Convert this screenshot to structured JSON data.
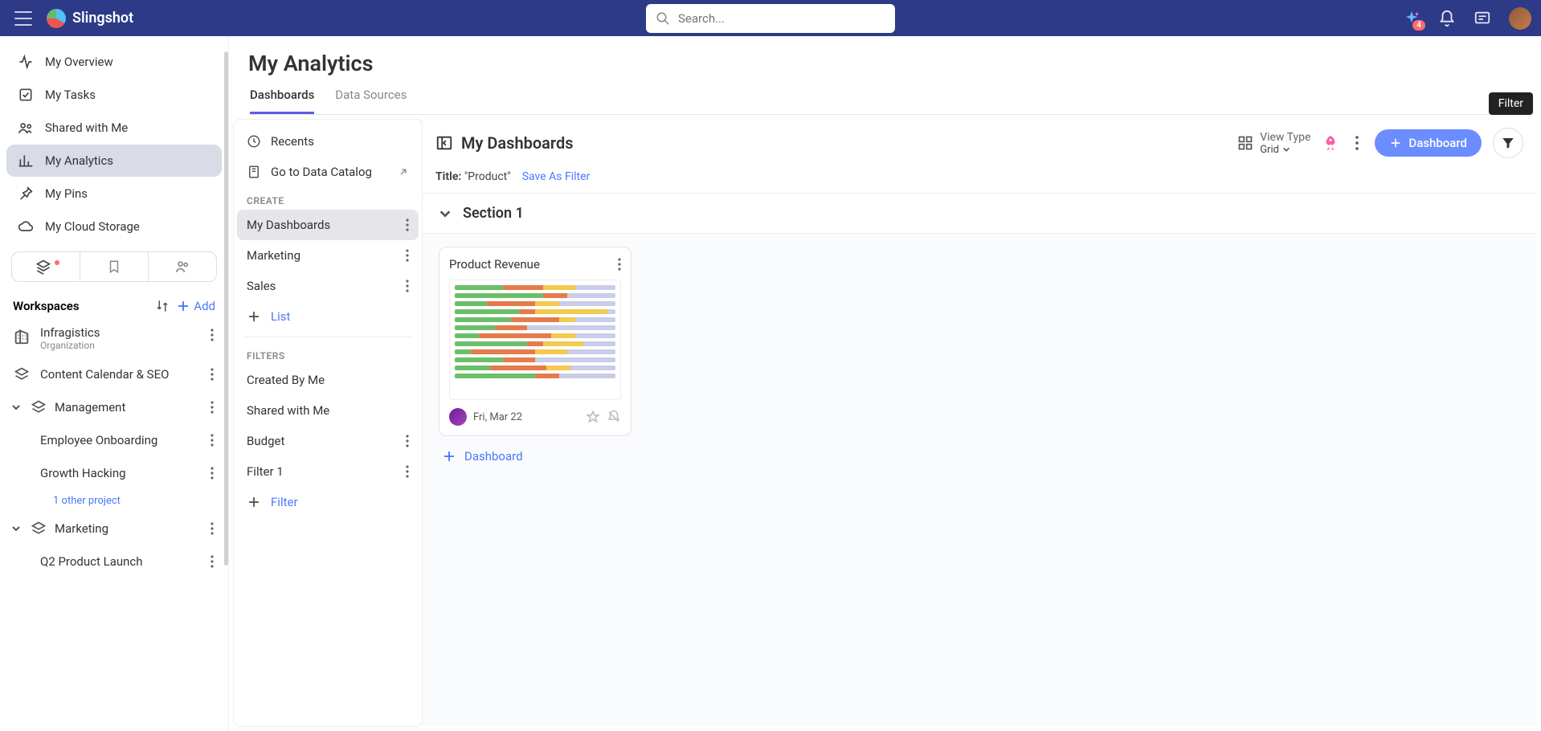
{
  "topbar": {
    "appName": "Slingshot",
    "searchPlaceholder": "Search...",
    "badgeCount": "4"
  },
  "sidebar": {
    "items": [
      {
        "label": "My Overview"
      },
      {
        "label": "My Tasks"
      },
      {
        "label": "Shared with Me"
      },
      {
        "label": "My Analytics"
      },
      {
        "label": "My Pins"
      },
      {
        "label": "My Cloud Storage"
      }
    ],
    "workspacesLabel": "Workspaces",
    "addLabel": "Add",
    "org": {
      "name": "Infragistics",
      "sub": "Organization"
    },
    "trees": [
      {
        "name": "Content Calendar & SEO",
        "children": [],
        "expanded": false
      },
      {
        "name": "Management",
        "children": [
          {
            "name": "Employee Onboarding"
          },
          {
            "name": "Growth Hacking"
          }
        ],
        "otherCount": "1 other project",
        "expanded": true
      },
      {
        "name": "Marketing",
        "children": [
          {
            "name": "Q2 Product Launch"
          }
        ],
        "expanded": true
      }
    ]
  },
  "main": {
    "title": "My Analytics",
    "tabs": [
      {
        "label": "Dashboards",
        "active": true
      },
      {
        "label": "Data Sources",
        "active": false
      }
    ]
  },
  "col2": {
    "recents": "Recents",
    "catalog": "Go to Data Catalog",
    "createHdr": "CREATE",
    "createItems": [
      {
        "label": "My Dashboards",
        "active": true
      },
      {
        "label": "Marketing"
      },
      {
        "label": "Sales"
      }
    ],
    "addList": "List",
    "filtersHdr": "FILTERS",
    "filterItems": [
      {
        "label": "Created By Me"
      },
      {
        "label": "Shared with Me"
      },
      {
        "label": "Budget"
      },
      {
        "label": "Filter 1"
      }
    ],
    "addFilter": "Filter"
  },
  "col3": {
    "paneTitle": "My Dashboards",
    "viewTypeLabel": "View Type",
    "viewTypeValue": "Grid",
    "dashboardBtn": "Dashboard",
    "filterTooltip": "Filter",
    "filterTitleLabel": "Title:",
    "filterTitleValue": "\"Product\"",
    "saveAsFilter": "Save As Filter",
    "sectionTitle": "Section 1",
    "card": {
      "title": "Product Revenue",
      "date": "Fri, Mar 22"
    },
    "addDashboard": "Dashboard"
  }
}
